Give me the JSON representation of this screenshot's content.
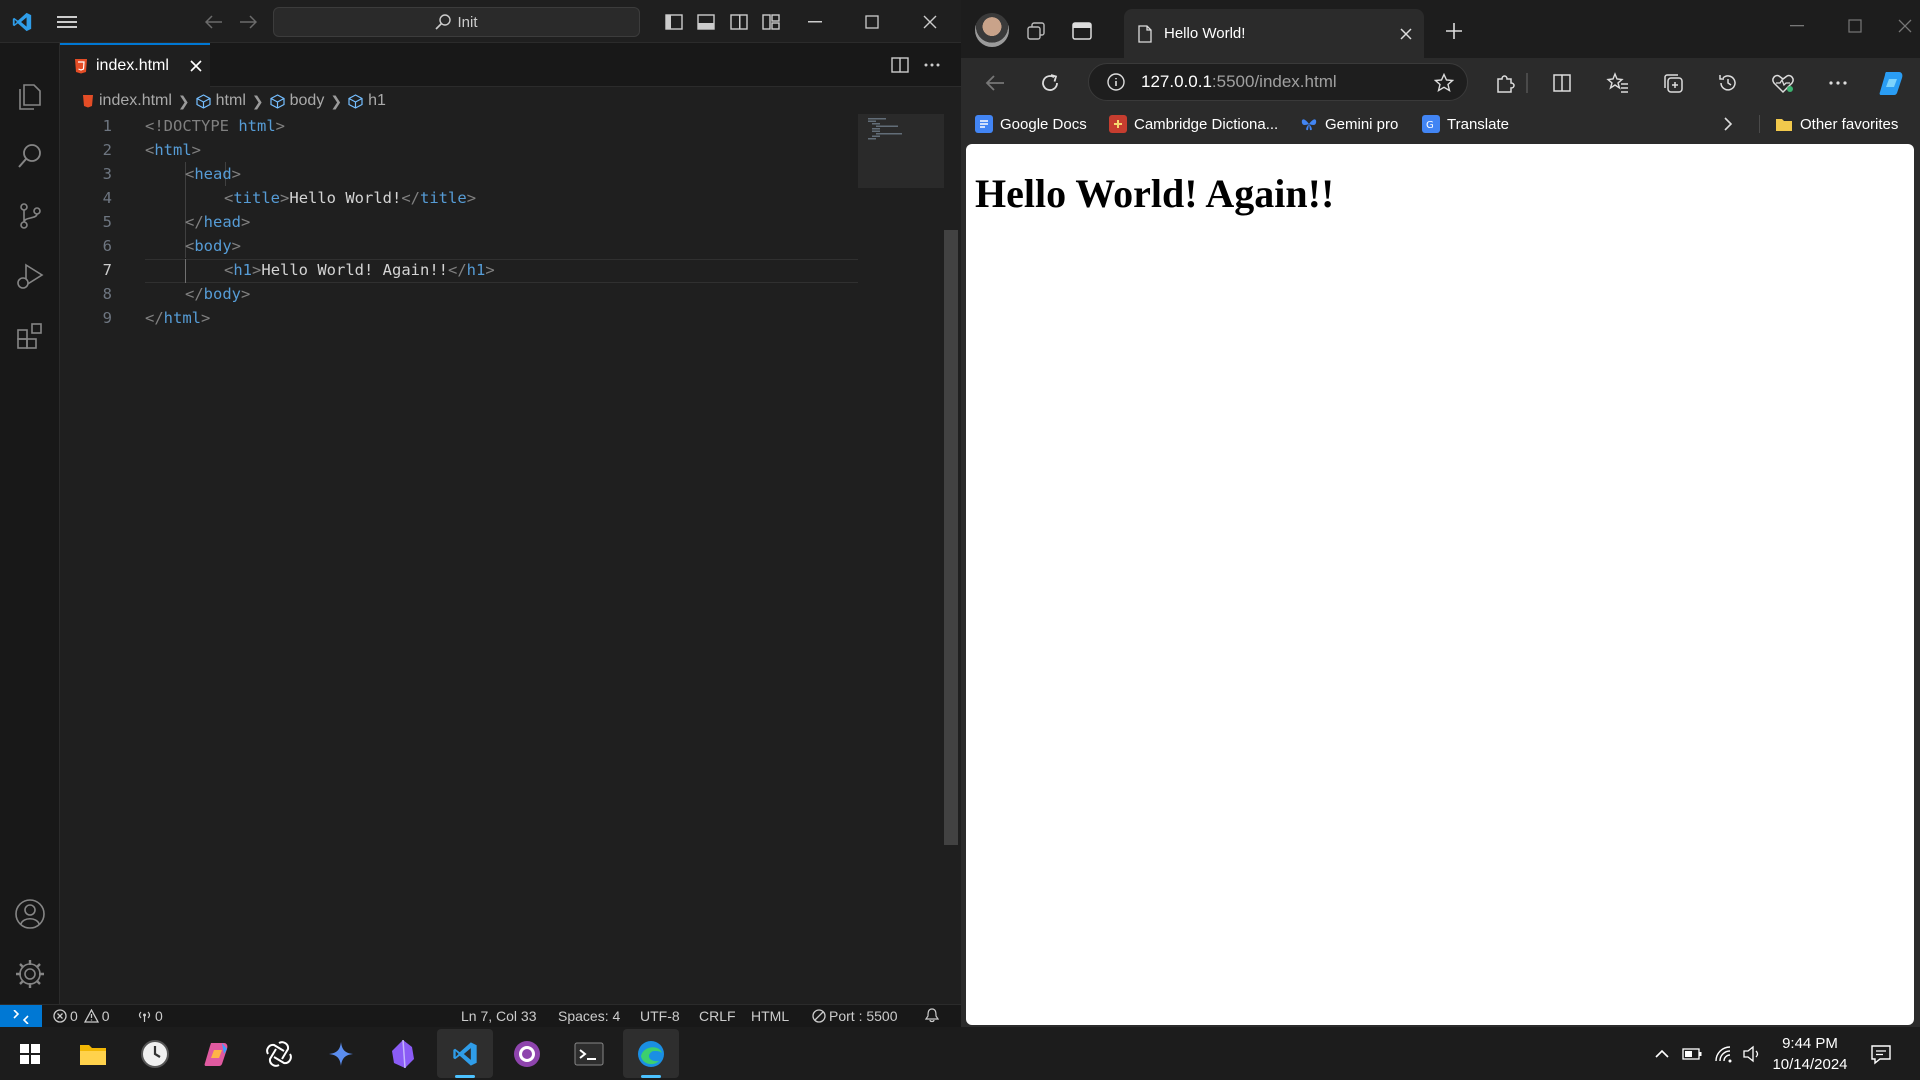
{
  "vscode": {
    "search_text": "Init",
    "tab_filename": "index.html",
    "breadcrumb": [
      "index.html",
      "html",
      "body",
      "h1"
    ],
    "line_numbers": [
      "1",
      "2",
      "3",
      "4",
      "5",
      "6",
      "7",
      "8",
      "9"
    ],
    "code": {
      "l1_open": "<!DOCTYPE ",
      "l1_kw": "html",
      "l1_close": ">",
      "l2": "html",
      "l3": "head",
      "l4_tag": "title",
      "l4_text": "Hello World!",
      "l5": "head",
      "l6": "body",
      "l7_tag": "h1",
      "l7_text": "Hello World! Again!!",
      "l8": "body",
      "l9": "html"
    },
    "status": {
      "errors": "0",
      "warnings": "0",
      "ports_count": "0",
      "position": "Ln 7, Col 33",
      "spaces": "Spaces: 4",
      "encoding": "UTF-8",
      "eol": "CRLF",
      "language": "HTML",
      "port": "Port : 5500"
    },
    "accent_color": "#0078d4"
  },
  "edge": {
    "tab_title": "Hello World!",
    "url_host": "127.0.0.1",
    "url_path": ":5500/index.html",
    "bookmarks": [
      "Google Docs",
      "Cambridge Dictiona...",
      "Gemini pro",
      "Translate"
    ],
    "other_favorites": "Other favorites",
    "page_heading": "Hello World! Again!!"
  },
  "taskbar": {
    "time": "9:44 PM",
    "date": "10/14/2024",
    "apps": [
      "start-icon",
      "file-explorer-icon",
      "clock-app-icon",
      "copilot-icon",
      "chatgpt-icon",
      "gemini-icon",
      "obsidian-icon",
      "vscode-icon",
      "github-desktop-icon",
      "terminal-icon",
      "edge-icon"
    ]
  }
}
